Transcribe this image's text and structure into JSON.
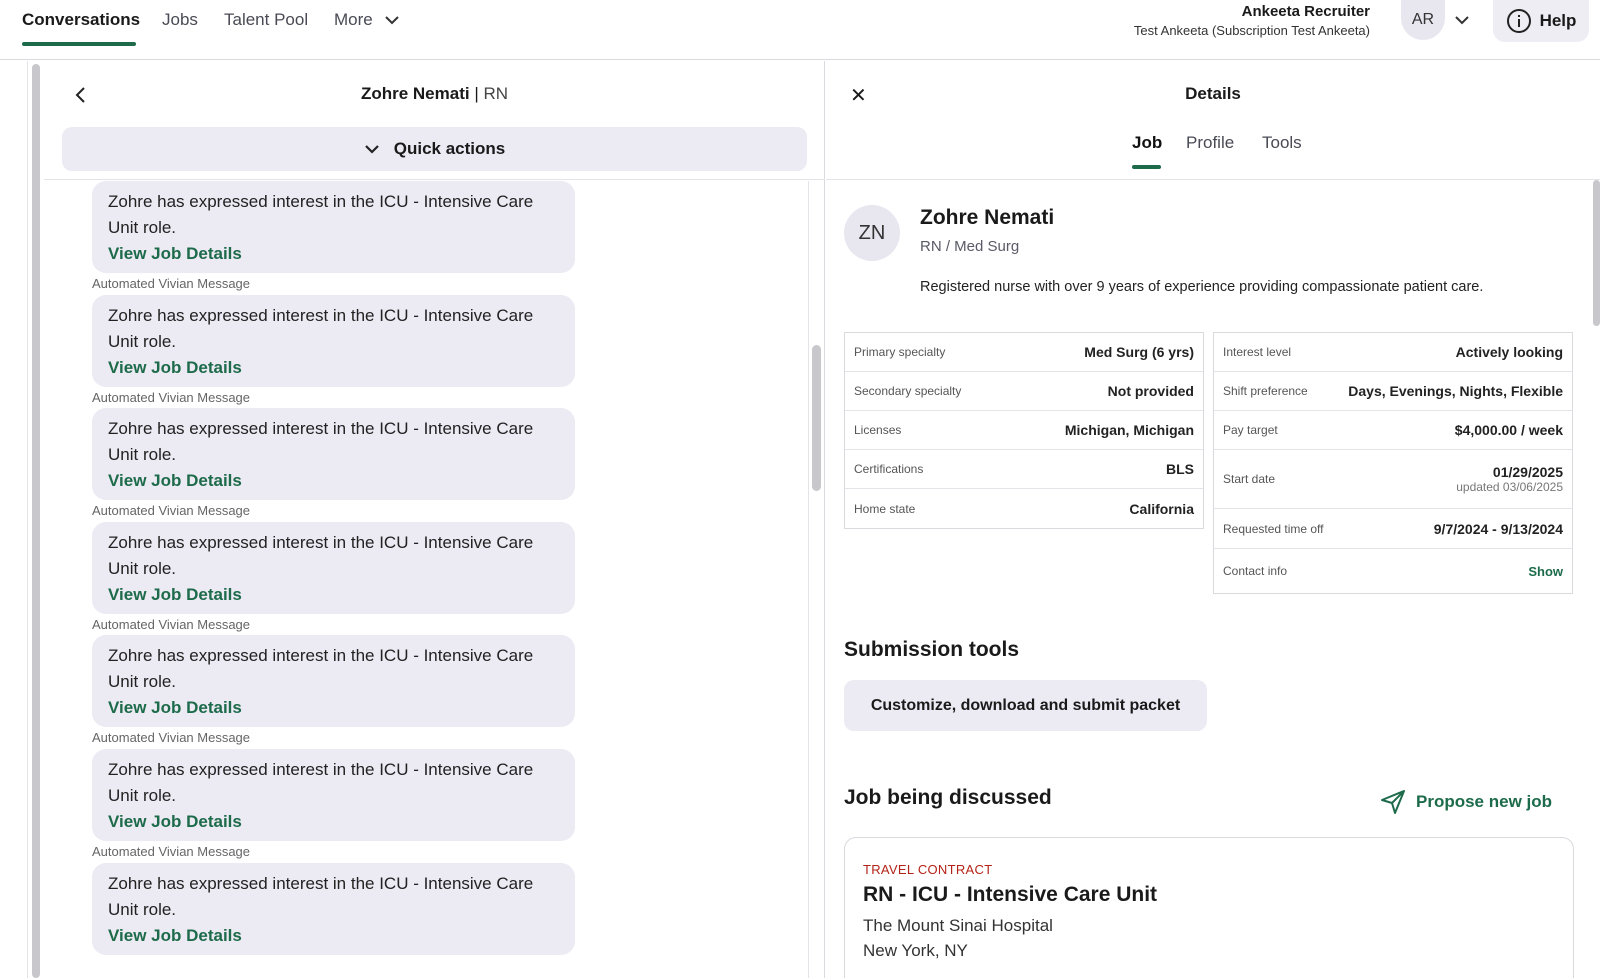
{
  "nav": {
    "tabs": [
      "Conversations",
      "Jobs",
      "Talent Pool",
      "More"
    ],
    "user_name": "Ankeeta Recruiter",
    "user_sub": "Test Ankeeta (Subscription Test Ankeeta)",
    "avatar": "AR",
    "help": "Help"
  },
  "conversation": {
    "name": "Zohre Nemati",
    "separator": " | ",
    "role": "RN",
    "quick_actions": "Quick actions",
    "messages": [
      {
        "text": "Zohre has expressed interest in the ICU - Intensive Care Unit role.",
        "link": "View Job Details",
        "caption": "Automated Vivian Message"
      },
      {
        "text": "Zohre has expressed interest in the ICU - Intensive Care Unit role.",
        "link": "View Job Details",
        "caption": "Automated Vivian Message"
      },
      {
        "text": "Zohre has expressed interest in the ICU - Intensive Care Unit role.",
        "link": "View Job Details",
        "caption": "Automated Vivian Message"
      },
      {
        "text": "Zohre has expressed interest in the ICU - Intensive Care Unit role.",
        "link": "View Job Details",
        "caption": "Automated Vivian Message"
      },
      {
        "text": "Zohre has expressed interest in the ICU - Intensive Care Unit role.",
        "link": "View Job Details",
        "caption": "Automated Vivian Message"
      },
      {
        "text": "Zohre has expressed interest in the ICU - Intensive Care Unit role.",
        "link": "View Job Details",
        "caption": "Automated Vivian Message"
      },
      {
        "text": "Zohre has expressed interest in the ICU - Intensive Care Unit role.",
        "link": "View Job Details",
        "caption": ""
      }
    ]
  },
  "details": {
    "title": "Details",
    "tabs": [
      "Job",
      "Profile",
      "Tools"
    ],
    "candidate": {
      "initials": "ZN",
      "name": "Zohre Nemati",
      "role": "RN / Med Surg",
      "bio": "Registered nurse with over 9 years of experience providing compassionate patient care."
    },
    "left_table": [
      {
        "label": "Primary specialty",
        "value": "Med Surg (6 yrs)"
      },
      {
        "label": "Secondary specialty",
        "value": "Not provided"
      },
      {
        "label": "Licenses",
        "value": "Michigan, Michigan"
      },
      {
        "label": "Certifications",
        "value": "BLS"
      },
      {
        "label": "Home state",
        "value": "California"
      }
    ],
    "right_table": [
      {
        "label": "Interest level",
        "value": "Actively looking"
      },
      {
        "label": "Shift preference",
        "value": "Days, Evenings, Nights, Flexible"
      },
      {
        "label": "Pay target",
        "value": "$4,000.00 / week"
      },
      {
        "label": "Start date",
        "value": "01/29/2025",
        "sub": "updated 03/06/2025"
      },
      {
        "label": "Requested time off",
        "value": "9/7/2024 - 9/13/2024"
      },
      {
        "label": "Contact info",
        "value": "Show"
      }
    ],
    "submission_title": "Submission tools",
    "packet_button": "Customize, download and submit packet",
    "job_section_title": "Job being discussed",
    "propose_label": "Propose new job",
    "job": {
      "type": "TRAVEL CONTRACT",
      "title": "RN - ICU - Intensive Care Unit",
      "facility": "The Mount Sinai Hospital",
      "location": "New York, NY"
    }
  }
}
